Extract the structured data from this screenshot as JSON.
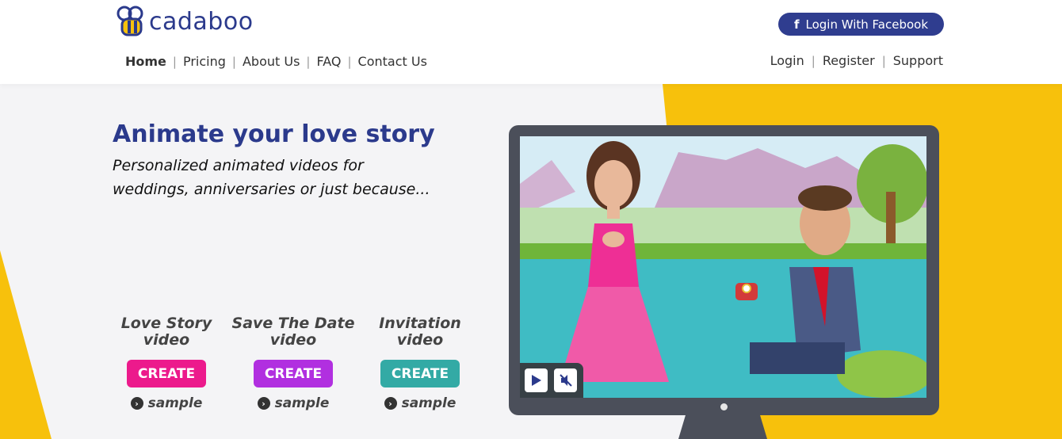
{
  "brand": {
    "name": "cadaboo"
  },
  "main_nav": [
    {
      "label": "Home"
    },
    {
      "label": "Pricing"
    },
    {
      "label": "About Us"
    },
    {
      "label": "FAQ"
    },
    {
      "label": "Contact Us"
    }
  ],
  "facebook_login": {
    "icon": "facebook-icon",
    "label": "Login With Facebook"
  },
  "user_nav": [
    {
      "label": "Login"
    },
    {
      "label": "Register"
    },
    {
      "label": "Support"
    }
  ],
  "hero": {
    "headline": "Animate your love story",
    "subline_1": "Personalized animated videos for",
    "subline_2": "weddings, anniversaries or just because..."
  },
  "cards": [
    {
      "title_1": "Love Story",
      "title_2": "video",
      "button": "CREATE",
      "sample": "sample",
      "color": "#ec1a8c"
    },
    {
      "title_1": "Save The Date",
      "title_2": "video",
      "button": "CREATE",
      "sample": "sample",
      "color": "#b12fe0"
    },
    {
      "title_1": "Invitation",
      "title_2": "video",
      "button": "CREATE",
      "sample": "sample",
      "color": "#33aaa5"
    }
  ],
  "player": {
    "play_icon": "play-icon",
    "mute_icon": "mute-icon"
  },
  "colors": {
    "accent_yellow": "#f7c10c",
    "brand_blue": "#2b3a8c",
    "monitor": "#4b4f5a"
  }
}
